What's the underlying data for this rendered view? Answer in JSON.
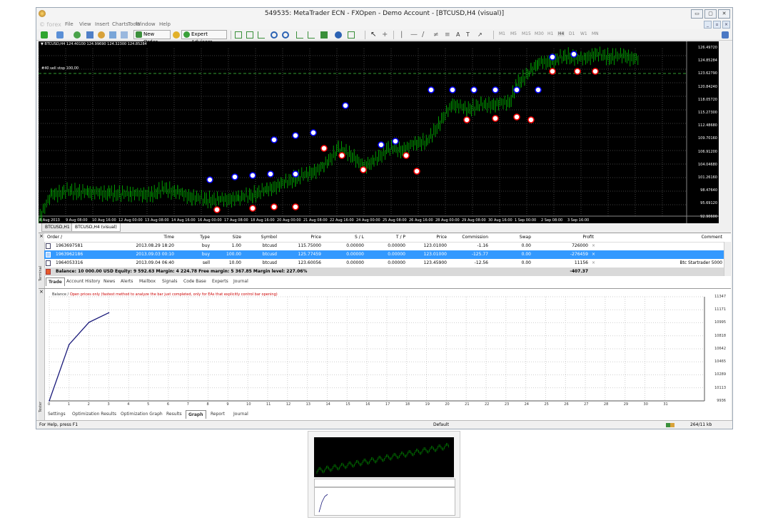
{
  "window": {
    "title": "549535: MetaTrader ECN - FXOpen - Demo Account - [BTCUSD,H4 (visual)]",
    "controls": [
      "▭",
      "▢",
      "✕"
    ],
    "mdi_controls": [
      "_",
      "▫",
      "×"
    ]
  },
  "menu": {
    "items": [
      "File",
      "View",
      "Insert",
      "Charts",
      "Tools",
      "Window",
      "Help"
    ],
    "watermark": "© forex"
  },
  "toolbar": {
    "new_order": "New Order",
    "expert_advisors": "Expert Advisors",
    "text_tool": "A",
    "label_tool": "T",
    "timeframes": [
      "M1",
      "M5",
      "M15",
      "M30",
      "H1",
      "H4",
      "D1",
      "W1",
      "MN"
    ],
    "active_timeframe": "H4"
  },
  "chart": {
    "info": "▼ BTCUSD,H4  124.40100 124.99690 124.32300 124.85284",
    "order_label": "#40 sell stop 100,00",
    "price_labels": [
      "126.49720",
      "124.85284",
      "123.62790",
      "120.84240",
      "118.05720",
      "115.27300",
      "112.48680",
      "109.70160",
      "106.91200",
      "104.04680",
      "101.26160",
      "98.47640",
      "95.69120",
      "92.90600"
    ],
    "time_labels": [
      "8 Aug 2013",
      "9 Aug 08:00",
      "10 Aug 16:00",
      "12 Aug 00:00",
      "13 Aug 08:00",
      "14 Aug 16:00",
      "16 Aug 00:00",
      "17 Aug 08:00",
      "18 Aug 16:00",
      "20 Aug 00:00",
      "21 Aug 08:00",
      "22 Aug 16:00",
      "24 Aug 00:00",
      "25 Aug 08:00",
      "26 Aug 16:00",
      "28 Aug 00:00",
      "29 Aug 08:00",
      "30 Aug 16:00",
      "1 Sep 00:00",
      "2 Sep 08:00",
      "3 Sep 16:00"
    ],
    "colors": {
      "bull": "#00c000",
      "bear": "#00c000",
      "grid": "#404040",
      "buy_marker": "#0000ff",
      "sell_marker": "#ff0000"
    }
  },
  "chart_tabs": [
    "BTCUSD,H1",
    "BTCUSD,H4 (visual)"
  ],
  "terminal": {
    "side_label": "Terminal",
    "columns": [
      "Order  /",
      "Time",
      "Type",
      "Size",
      "Symbol",
      "Price",
      "S / L",
      "T / P",
      "Price",
      "Commission",
      "Swap",
      "Profit",
      "Comment"
    ],
    "rows": [
      [
        "1963697581",
        "2013.08.29 18:20",
        "buy",
        "1.00",
        "btcusd",
        "115.75000",
        "0.00000",
        "0.00000",
        "123.01000",
        "-1.16",
        "0.00",
        "726000",
        ""
      ],
      [
        "1963962186",
        "2013.09.03 00:10",
        "buy",
        "100.00",
        "btcusd",
        "125.77459",
        "0.00000",
        "0.00000",
        "123.01000",
        "-125.77",
        "0.00",
        "-276459",
        ""
      ],
      [
        "1964053316",
        "2013.09.04 06:40",
        "sell",
        "10.00",
        "btcusd",
        "123.60056",
        "0.00000",
        "0.00000",
        "123.45900",
        "-12.56",
        "0.00",
        "11156",
        "Btc Startrader 5000"
      ]
    ],
    "summary": "Balance: 10 000.00 USD  Equity: 9 592.63  Margin: 4 224.78  Free margin: 5 367.85  Margin level: 227.06%",
    "summary_profit": "-407.37",
    "close_mark": "×",
    "tabs": [
      "Trade",
      "Account History",
      "News",
      "Alerts",
      "Mailbox",
      "Signals",
      "Code Base",
      "Experts",
      "Journal"
    ],
    "active_tab": "Trade"
  },
  "tester": {
    "side_label": "Tester",
    "legend_prefix": "Balance / ",
    "legend_note": "Open prices only (fastest method to analyze the bar just completed, only for EAs that explicitly control bar opening)",
    "tabs": [
      "Settings",
      "Optimization Results",
      "Optimization Graph",
      "Results",
      "Graph",
      "Report",
      "Journal"
    ],
    "active_tab": "Graph"
  },
  "chart_data": {
    "type": "line",
    "x": [
      0,
      1,
      2,
      3
    ],
    "series": [
      {
        "name": "Balance",
        "values": [
          9936,
          10700,
          11000,
          11130
        ]
      }
    ],
    "x_ticks": [
      "0",
      "1",
      "2",
      "3",
      "4",
      "5",
      "6",
      "7",
      "8",
      "9",
      "10",
      "11",
      "12",
      "13",
      "14",
      "15",
      "16",
      "17",
      "18",
      "19",
      "20",
      "21",
      "22",
      "23",
      "24",
      "25",
      "26",
      "27",
      "28",
      "29",
      "30",
      "31"
    ],
    "y_ticks": [
      "11347",
      "11171",
      "10995",
      "10818",
      "10642",
      "10465",
      "10289",
      "10113",
      "9936"
    ],
    "xlim": [
      0,
      33
    ],
    "ylim": [
      9936,
      11347
    ],
    "grid": true,
    "line_color": "#1a1a7a"
  },
  "status": {
    "help": "For Help, press F1",
    "profile": "Default",
    "traffic": "264/11 kb"
  }
}
